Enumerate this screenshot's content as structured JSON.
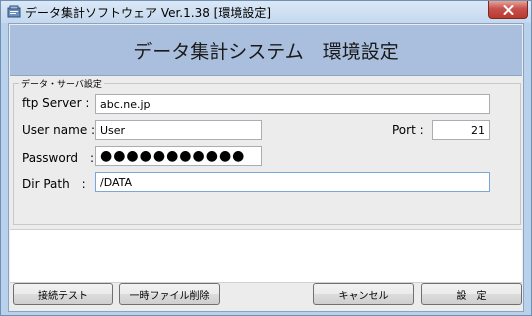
{
  "window": {
    "title": "データ集計ソフトウェア Ver.1.38 [環境設定]",
    "close_icon": "close-x-icon"
  },
  "banner": {
    "title": "データ集計システム　環境設定"
  },
  "group": {
    "label": "データ・サーバ設定"
  },
  "form": {
    "ftp_server_label": "ftp Server :",
    "ftp_server_value": "abc.ne.jp",
    "user_name_label": "User name :",
    "user_name_value": "User",
    "port_label": "Port :",
    "port_value": "21",
    "password_label": "Password　:",
    "password_value": "●●●●●●●●●●●",
    "dir_path_label": "Dir Path　:",
    "dir_path_value": "/DATA"
  },
  "buttons": {
    "test_connection": "接続テスト",
    "delete_temp": "一時ファイル削除",
    "cancel": "キャンセル",
    "save": "設　定"
  },
  "colors": {
    "banner_bg": "#a9bfdd",
    "window_frame": "#b9d1ea",
    "close_button": "#c75050"
  }
}
